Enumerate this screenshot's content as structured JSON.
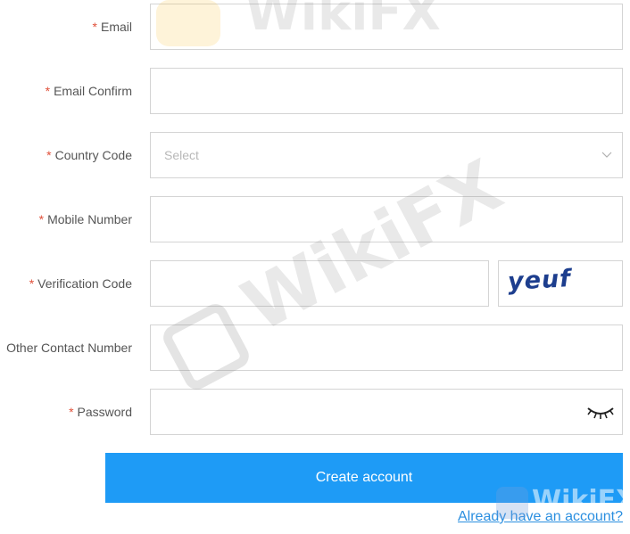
{
  "form": {
    "email": {
      "label": "Email",
      "required": "*",
      "value": "",
      "placeholder": ""
    },
    "email_confirm": {
      "label": "Email Confirm",
      "required": "*",
      "value": "",
      "placeholder": ""
    },
    "country_code": {
      "label": "Country Code",
      "required": "*",
      "selected": "Select"
    },
    "mobile_number": {
      "label": "Mobile Number",
      "required": "*",
      "value": "",
      "placeholder": ""
    },
    "verification_code": {
      "label": "Verification Code",
      "required": "*",
      "value": "",
      "placeholder": "",
      "captcha_text": "yeuf"
    },
    "other_contact": {
      "label": "Other Contact Number",
      "value": "",
      "placeholder": ""
    },
    "password": {
      "label": "Password",
      "required": "*",
      "value": "",
      "placeholder": ""
    }
  },
  "actions": {
    "create_account": "Create account",
    "login_link": "Already have an account?"
  },
  "watermark": {
    "text": "WikiFX"
  },
  "icons": {
    "select_chevron": "chevron-down-icon",
    "password_toggle": "eye-closed-icon"
  },
  "colors": {
    "primary": "#1e9bf6",
    "required": "#e0503a",
    "link": "#2b8fe0",
    "border": "#d4d4d4",
    "captcha": "#1d3e8e"
  }
}
